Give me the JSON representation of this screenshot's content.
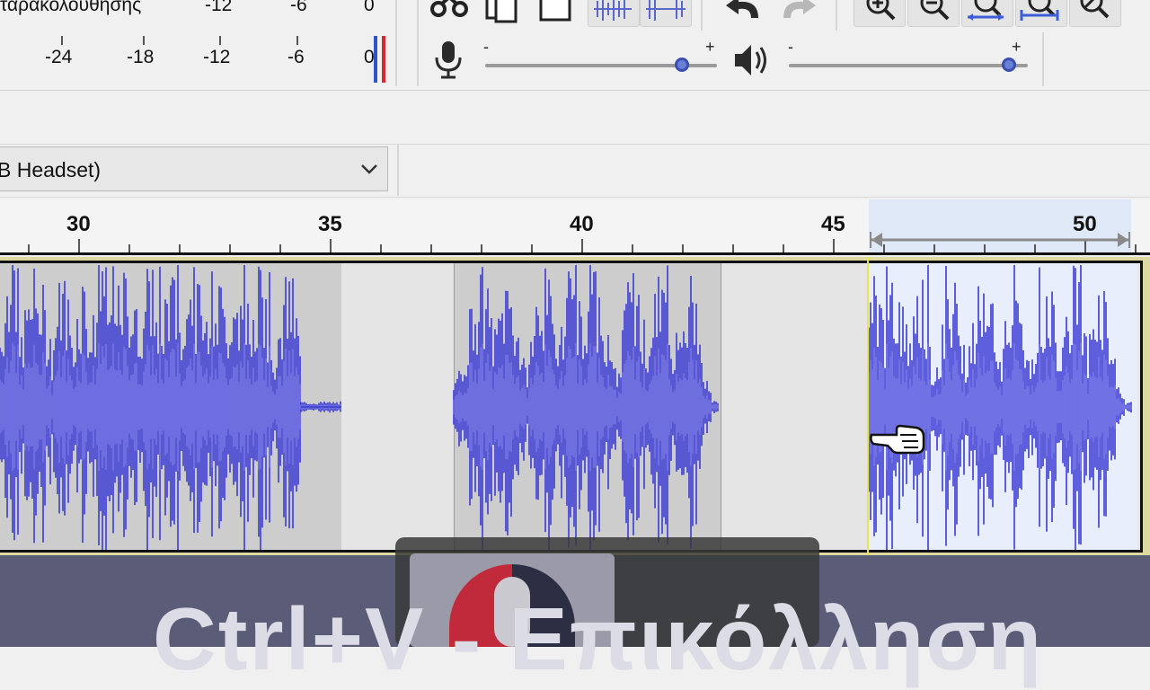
{
  "meter": {
    "record_label": "ταρακολούθησης",
    "top_scale": [
      "-12",
      "-6",
      "0"
    ],
    "scale": [
      "-24",
      "-18",
      "-12",
      "-6",
      "0"
    ]
  },
  "mixer": {
    "mic_minus": "-",
    "mic_plus": "+",
    "mic_level": 0.85,
    "speaker_minus": "-",
    "speaker_plus": "+",
    "speaker_level": 0.92
  },
  "device": {
    "label": "B Headset)"
  },
  "ruler": {
    "labels": [
      "30",
      "35",
      "40",
      "45",
      "50"
    ]
  },
  "selection": {
    "start": 46.8,
    "end": 52
  },
  "caption": {
    "text": "Ctrl+V - Επικόλληση"
  },
  "colors": {
    "waveform": "#3b3bd4",
    "waveform_rms": "#6d6de3",
    "cursor": "#e6e64a",
    "selection": "#e8eefb"
  }
}
